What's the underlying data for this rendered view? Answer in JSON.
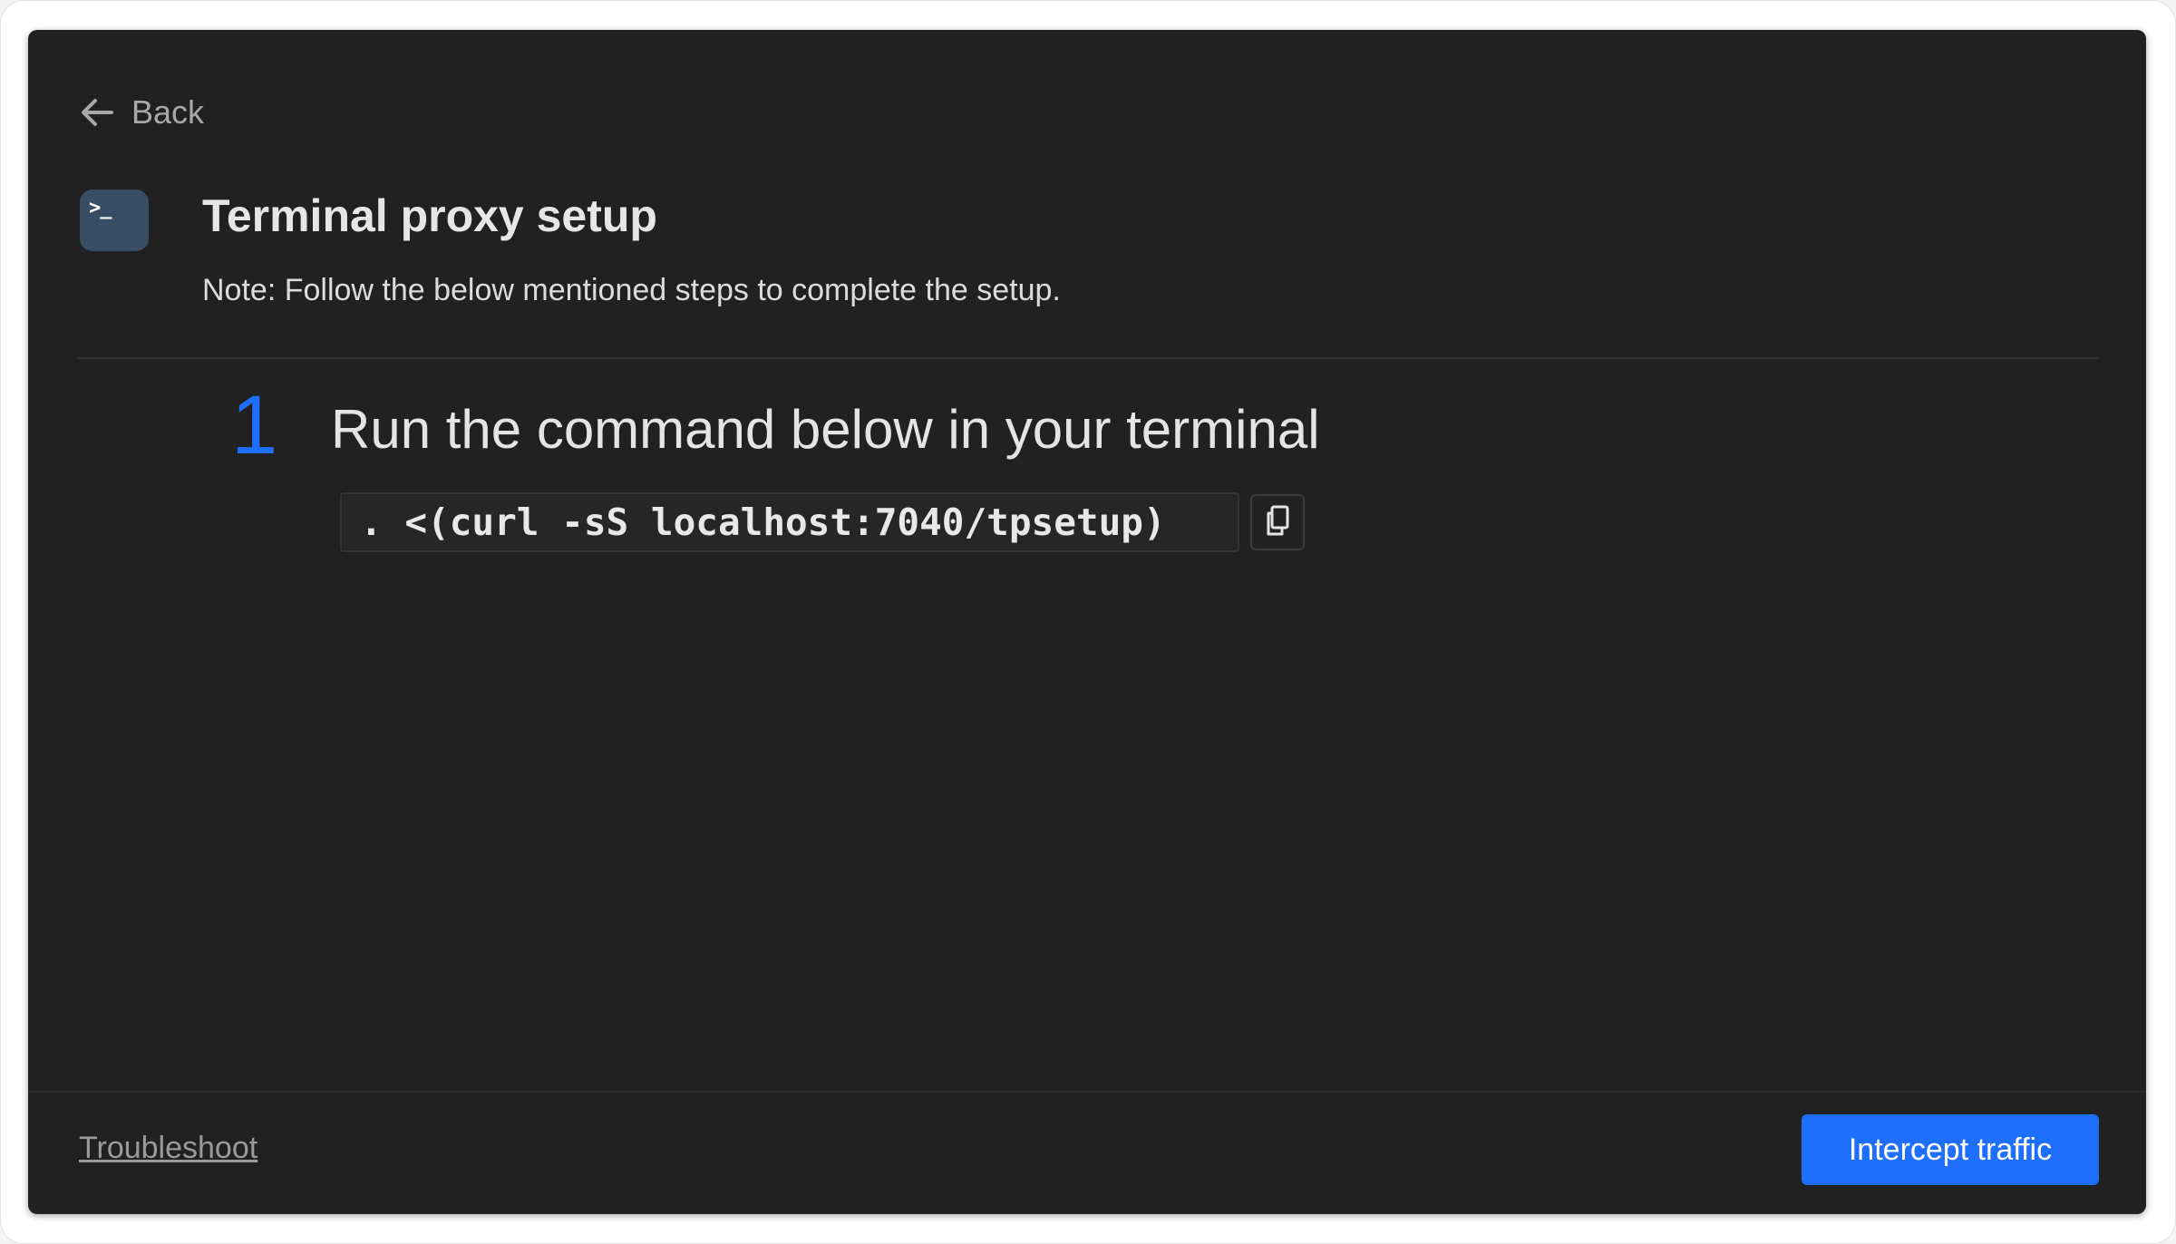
{
  "nav": {
    "back_label": "Back"
  },
  "header": {
    "icon_glyph": ">_",
    "title": "Terminal proxy setup",
    "note": "Note: Follow the below mentioned steps to complete the setup."
  },
  "steps": [
    {
      "number": "1",
      "title": "Run the command below in your terminal",
      "command": ". <(curl -sS localhost:7040/tpsetup)"
    }
  ],
  "footer": {
    "troubleshoot_label": "Troubleshoot",
    "primary_button_label": "Intercept traffic"
  },
  "colors": {
    "accent": "#1f6fff",
    "panel_background": "#212121",
    "icon_background": "#3a4d66"
  }
}
